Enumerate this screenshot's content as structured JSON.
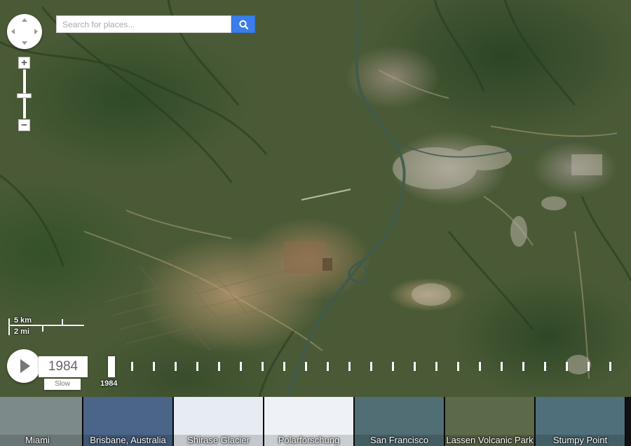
{
  "search": {
    "placeholder": "Search for places..."
  },
  "zoom": {
    "in_label": "+",
    "out_label": "−"
  },
  "scale": {
    "km_label": "5 km",
    "mi_label": "2 mi"
  },
  "player": {
    "year": "1984",
    "speed": "Slow",
    "timeline_label": "1984",
    "tick_count": 24
  },
  "thumbnails": [
    {
      "label": "Miami",
      "bg": "#7d8a8a"
    },
    {
      "label": "Brisbane, Australia",
      "bg": "#4a6588"
    },
    {
      "label": "Shirase Glacier",
      "bg": "#e6ecf2"
    },
    {
      "label": "Polarforschung",
      "bg": "#eef2f6"
    },
    {
      "label": "San Francisco",
      "bg": "#506e74"
    },
    {
      "label": "Lassen Volcanic Park",
      "bg": "#5d6a4a"
    },
    {
      "label": "Stumpy Point",
      "bg": "#4f6f7a"
    }
  ],
  "colors": {
    "accent": "#3b7de9",
    "river": "#3f5a4c"
  }
}
